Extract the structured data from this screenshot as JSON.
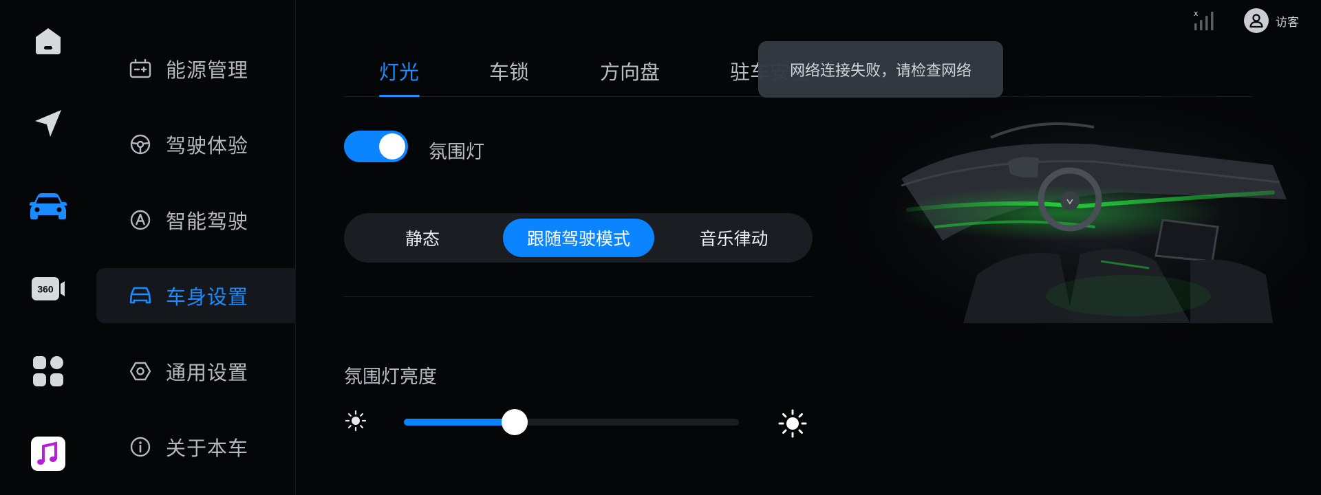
{
  "rail": {
    "items": [
      {
        "name": "home",
        "icon": "home-icon",
        "active": false
      },
      {
        "name": "navigation",
        "icon": "navigation-arrow-icon",
        "active": false
      },
      {
        "name": "vehicle",
        "icon": "car-icon",
        "active": true
      },
      {
        "name": "camera-360",
        "icon": "camera-360-icon",
        "label": "360",
        "active": false
      },
      {
        "name": "apps",
        "icon": "apps-grid-icon",
        "active": false
      },
      {
        "name": "music",
        "icon": "music-app-icon",
        "active": false
      }
    ]
  },
  "menu": {
    "items": [
      {
        "label": "能源管理",
        "icon": "battery-energy-icon",
        "active": false
      },
      {
        "label": "驾驶体验",
        "icon": "steering-wheel-icon",
        "active": false
      },
      {
        "label": "智能驾驶",
        "icon": "autopilot-icon",
        "active": false
      },
      {
        "label": "车身设置",
        "icon": "car-body-icon",
        "active": true
      },
      {
        "label": "通用设置",
        "icon": "hexagon-settings-icon",
        "active": false
      },
      {
        "label": "关于本车",
        "icon": "info-icon",
        "active": false
      }
    ]
  },
  "status": {
    "signal_mark": "x",
    "user_label": "访客"
  },
  "tabs": [
    {
      "label": "灯光",
      "active": true
    },
    {
      "label": "车锁",
      "active": false
    },
    {
      "label": "方向盘",
      "active": false
    },
    {
      "label": "驻车安全",
      "active": false
    }
  ],
  "toast": {
    "text": "网络连接失败，请检查网络"
  },
  "ambient": {
    "toggle_label": "氛围灯",
    "toggle_on": true,
    "modes": [
      {
        "label": "静态",
        "active": false
      },
      {
        "label": "跟随驾驶模式",
        "active": true
      },
      {
        "label": "音乐律动",
        "active": false
      }
    ],
    "brightness_label": "氛围灯亮度",
    "brightness_fraction": 0.33
  },
  "colors": {
    "accent": "#0a84ff",
    "active_text": "#1a8cff",
    "ambient_light": "#22d13a"
  }
}
